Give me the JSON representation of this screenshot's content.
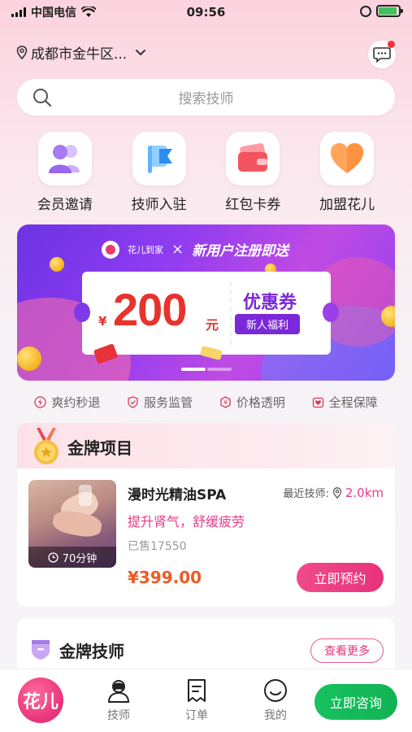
{
  "status_bar": {
    "carrier": "中国电信",
    "time": "09:56",
    "battery_level": 0.9
  },
  "header": {
    "location": "成都市金牛区...",
    "search_placeholder": "搜索技师"
  },
  "quick_nav": [
    {
      "label": "会员邀请",
      "icon": "members-icon"
    },
    {
      "label": "技师入驻",
      "icon": "flag-icon"
    },
    {
      "label": "红包卡券",
      "icon": "wallet-icon"
    },
    {
      "label": "加盟花儿",
      "icon": "heart-icon"
    }
  ],
  "banner": {
    "brand": "花儿到家",
    "headline": "新用户注册即送",
    "currency": "¥",
    "amount": "200",
    "unit": "元",
    "coupon_label": "优惠券",
    "newbie_label": "新人福利",
    "active_slide": 1,
    "slide_count": 2
  },
  "features": [
    "爽约秒退",
    "服务监管",
    "价格透明",
    "全程保障"
  ],
  "gold_projects": {
    "title": "金牌项目",
    "item": {
      "name": "漫时光精油SPA",
      "nearest_label": "最近技师:",
      "distance": "2.0km",
      "tagline": "提升肾气，舒缓疲劳",
      "sold": "已售17550",
      "price": "¥399.00",
      "duration": "70分钟",
      "book_label": "立即预约"
    }
  },
  "gold_techs": {
    "title": "金牌技师",
    "more_label": "查看更多"
  },
  "tabbar": {
    "logo_text": "花儿",
    "tabs": [
      {
        "label": "技师"
      },
      {
        "label": "订单"
      },
      {
        "label": "我的"
      }
    ],
    "consult_label": "立即咨询"
  },
  "colors": {
    "accent": "#e8327a",
    "price": "#ef5a24",
    "consult": "#18c15e"
  }
}
